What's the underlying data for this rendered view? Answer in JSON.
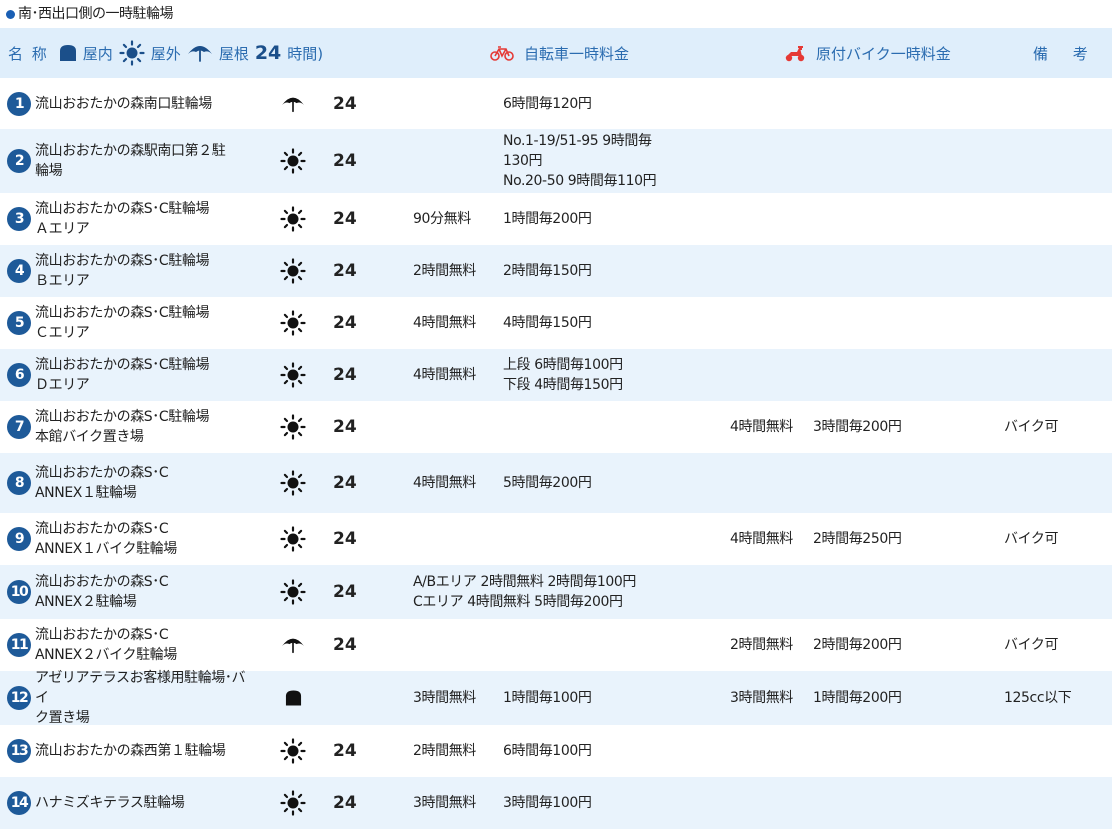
{
  "section_title": "南･西出口側の一時駐輪場",
  "legend": {
    "name": "名 称",
    "indoor": "屋内",
    "outdoor": "屋外",
    "roof": "屋根",
    "h24_num": "24",
    "h24_text": "時間)",
    "bicycle_fee": "自転車一時料金",
    "moped_fee": "原付バイク一時料金",
    "remarks": "備 考"
  },
  "colors": {
    "header_bg": "#dfeefb",
    "stripe_bg": "#e9f3fc",
    "badge": "#1e5a99",
    "header_text": "#2b6cb0",
    "moped_icon": "#e53935"
  },
  "rows": [
    {
      "no": "1",
      "name": "流山おおたかの森南口駐輪場",
      "type": "roof-icon",
      "h24": "24",
      "bike_free": "",
      "bike_fee": "6時間毎120円",
      "moto_free": "",
      "moto_fee": "",
      "note": ""
    },
    {
      "no": "2",
      "name": "流山おおたかの森駅南口第２駐\n輪場",
      "type": "sun-icon",
      "h24": "24",
      "bike_free": "",
      "bike_fee": "No.1-19/51-95 9時間毎\n130円\nNo.20-50 9時間毎110円",
      "moto_free": "",
      "moto_fee": "",
      "note": ""
    },
    {
      "no": "3",
      "name": "流山おおたかの森S･C駐輪場\nＡエリア",
      "type": "sun-icon",
      "h24": "24",
      "bike_free": "90分無料",
      "bike_fee": "1時間毎200円",
      "moto_free": "",
      "moto_fee": "",
      "note": ""
    },
    {
      "no": "4",
      "name": "流山おおたかの森S･C駐輪場\nＢエリア",
      "type": "sun-icon",
      "h24": "24",
      "bike_free": "2時間無料",
      "bike_fee": "2時間毎150円",
      "moto_free": "",
      "moto_fee": "",
      "note": ""
    },
    {
      "no": "5",
      "name": "流山おおたかの森S･C駐輪場\nＣエリア",
      "type": "sun-icon",
      "h24": "24",
      "bike_free": "4時間無料",
      "bike_fee": "4時間毎150円",
      "moto_free": "",
      "moto_fee": "",
      "note": ""
    },
    {
      "no": "6",
      "name": "流山おおたかの森S･C駐輪場\nＤエリア",
      "type": "sun-icon",
      "h24": "24",
      "bike_free": "4時間無料",
      "bike_fee": "上段 6時間毎100円\n下段 4時間毎150円",
      "moto_free": "",
      "moto_fee": "",
      "note": ""
    },
    {
      "no": "7",
      "name": "流山おおたかの森S･C駐輪場\n本館バイク置き場",
      "type": "sun-icon",
      "h24": "24",
      "bike_free": "",
      "bike_fee": "",
      "moto_free": "4時間無料",
      "moto_fee": "3時間毎200円",
      "note": "バイク可"
    },
    {
      "no": "8",
      "name": "流山おおたかの森S･C\nANNEX１駐輪場",
      "type": "sun-icon",
      "h24": "24",
      "bike_free": "4時間無料",
      "bike_fee": "5時間毎200円",
      "moto_free": "",
      "moto_fee": "",
      "note": ""
    },
    {
      "no": "9",
      "name": "流山おおたかの森S･C\nANNEX１バイク駐輪場",
      "type": "sun-icon",
      "h24": "24",
      "bike_free": "",
      "bike_fee": "",
      "moto_free": "4時間無料",
      "moto_fee": "2時間毎250円",
      "note": "バイク可"
    },
    {
      "no": "10",
      "name": "流山おおたかの森S･C\nANNEX２駐輪場",
      "type": "sun-icon",
      "h24": "24",
      "bike_wide": "A/Bエリア 2時間無料 2時間毎100円\nCエリア 4時間無料 5時間毎200円",
      "moto_free": "",
      "moto_fee": "",
      "note": ""
    },
    {
      "no": "11",
      "name": "流山おおたかの森S･C\nANNEX２バイク駐輪場",
      "type": "roof-icon",
      "h24": "24",
      "bike_free": "",
      "bike_fee": "",
      "moto_free": "2時間無料",
      "moto_fee": "2時間毎200円",
      "note": "バイク可"
    },
    {
      "no": "12",
      "name": "アゼリアテラスお客様用駐輪場･バイ\nク置き場",
      "type": "indoor-icon",
      "h24": "",
      "bike_free": "3時間無料",
      "bike_fee": "1時間毎100円",
      "moto_free": "3時間無料",
      "moto_fee": "1時間毎200円",
      "note": "125cc以下"
    },
    {
      "no": "13",
      "name": "流山おおたかの森西第１駐輪場",
      "type": "sun-icon",
      "h24": "24",
      "bike_free": "2時間無料",
      "bike_fee": "6時間毎100円",
      "moto_free": "",
      "moto_fee": "",
      "note": ""
    },
    {
      "no": "14",
      "name": "ハナミズキテラス駐輪場",
      "type": "sun-icon",
      "h24": "24",
      "bike_free": "3時間無料",
      "bike_fee": "3時間毎100円",
      "moto_free": "",
      "moto_fee": "",
      "note": ""
    }
  ]
}
